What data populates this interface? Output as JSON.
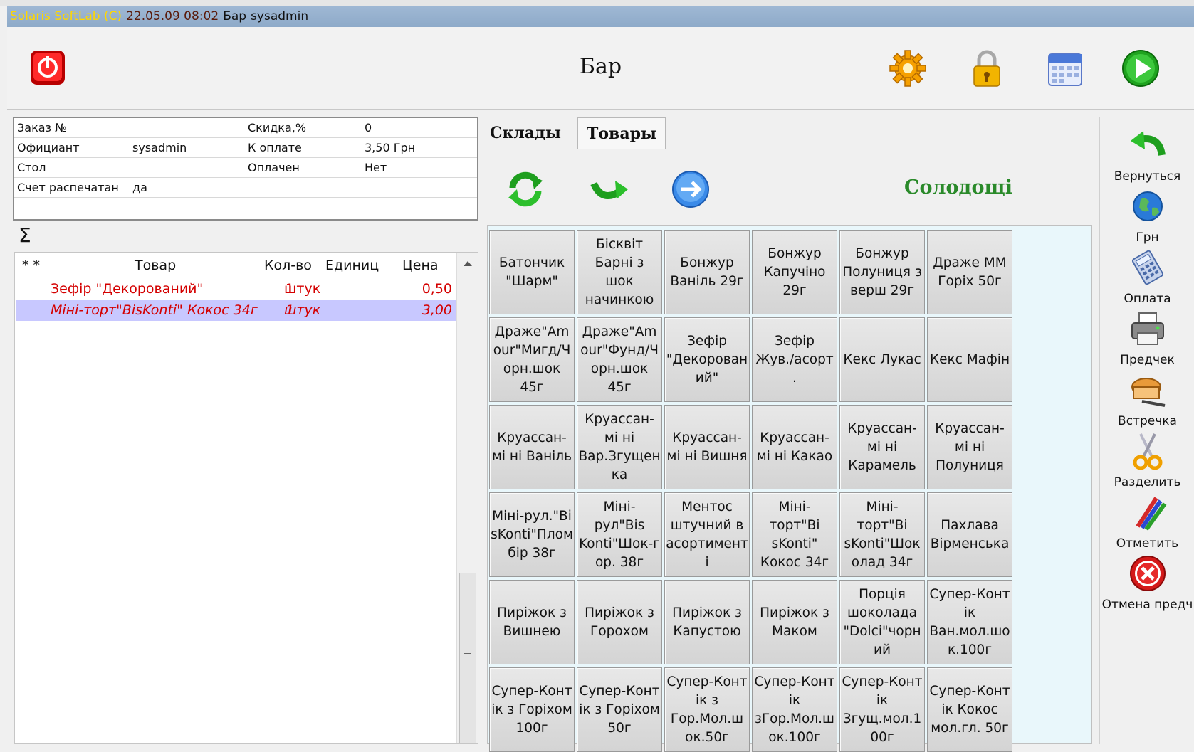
{
  "titlebar": {
    "brand": "Solaris SoftLab (C)",
    "datetime": "22.05.09 08:02",
    "section": "Бар",
    "user": "sysadmin"
  },
  "header": {
    "title": "Бар"
  },
  "order_info": {
    "order_no_label": "Заказ №",
    "order_no_value": "",
    "discount_label": "Скидка,%",
    "discount_value": "0",
    "waiter_label": "Официант",
    "waiter_value": "sysadmin",
    "to_pay_label": "К оплате",
    "to_pay_value": "3,50 Грн",
    "table_label": "Стол",
    "table_value": "",
    "paid_label": "Оплачен",
    "paid_value": "Нет",
    "check_printed_label": "Счет распечатан",
    "check_printed_value": "да"
  },
  "order_table": {
    "sigma": "Σ",
    "columns": {
      "marks": "* *",
      "product": "Товар",
      "qty": "Кол-во",
      "unit": "Единиц",
      "price": "Цена"
    },
    "rows": [
      {
        "product": "Зефір \"Декорований\"",
        "qty": "1",
        "unit": "штук",
        "price": "0,50",
        "selected": false
      },
      {
        "product": "Міні-торт\"BisKonti\" Кокос 34г",
        "qty": "1",
        "unit": "штук",
        "price": "3,00",
        "selected": true
      }
    ]
  },
  "tabs": [
    {
      "label": "Склады",
      "active": false
    },
    {
      "label": "Товары",
      "active": true
    }
  ],
  "category": "Солодощі",
  "products": [
    "Батончик \"Шарм\"",
    "Бісквіт Барні з шок начинкою",
    "Бонжур Ваніль 29г",
    "Бонжур Капучіно 29г",
    "Бонжур Полуниця з верш 29г",
    "Драже ММ Горіх 50г",
    "Драже\"Am our\"Мигд/Ч орн.шок 45г",
    "Драже\"Am our\"Фунд/Ч орн.шок 45г",
    "Зефір \"Декорован ий\"",
    "Зефір Жув./асорт .",
    "Кекс Лукас",
    "Кекс Мафін",
    "Круассан-мі ні Ваніль",
    "Круассан-мі ні Вар.Згущен ка",
    "Круассан-мі ні Вишня",
    "Круассан-мі ні Какао",
    "Круассан-мі ні Карамель",
    "Круассан-мі ні Полуниця",
    "Міні-рул.\"Bi sKonti\"Плом бір 38г",
    "Міні-рул\"Bis Konti\"Шок-г ор. 38г",
    "Ментос штучний в асортимент і",
    "Міні-торт\"Bi sKonti\" Кокос 34г",
    "Міні-торт\"Bi sKonti\"Шок олад 34г",
    "Пахлава Вірменська",
    "Пиріжок з Вишнею",
    "Пиріжок з Горохом",
    "Пиріжок з Капустою",
    "Пиріжок з Маком",
    "Порція шоколада \"Dolci\"чорн ий",
    "Супер-Конт ік Ван.мол.шо к.100г",
    "Супер-Конт ік з Горіхом 100г",
    "Супер-Конт ік з Горіхом 50г",
    "Супер-Конт ік з Гор.Мол.ш ок.50г",
    "Супер-Конт ік зГор.Мол.ш ок.100г",
    "Супер-Конт ік Згущ.мол.1 00г",
    "Супер-Конт ік Кокос мол.гл. 50г"
  ],
  "sidebar": [
    {
      "label": "Вернуться",
      "icon": "back-arrow-icon"
    },
    {
      "label": "Грн",
      "icon": "globe-icon"
    },
    {
      "label": "Оплата",
      "icon": "calculator-icon"
    },
    {
      "label": "Предчек",
      "icon": "printer-icon"
    },
    {
      "label": "Встречка",
      "icon": "bread-knife-icon"
    },
    {
      "label": "Разделить",
      "icon": "scissors-icon"
    },
    {
      "label": "Отметить",
      "icon": "pens-icon"
    },
    {
      "label": "Отмена предч",
      "icon": "cancel-icon"
    }
  ],
  "colors": {
    "titlebar": "#8eaac9",
    "brand": "#ffd700",
    "order_text": "#d40000",
    "selected_row": "#c8c8ff",
    "category": "#2a8a2a",
    "grid_bg": "#e9f7fb"
  }
}
